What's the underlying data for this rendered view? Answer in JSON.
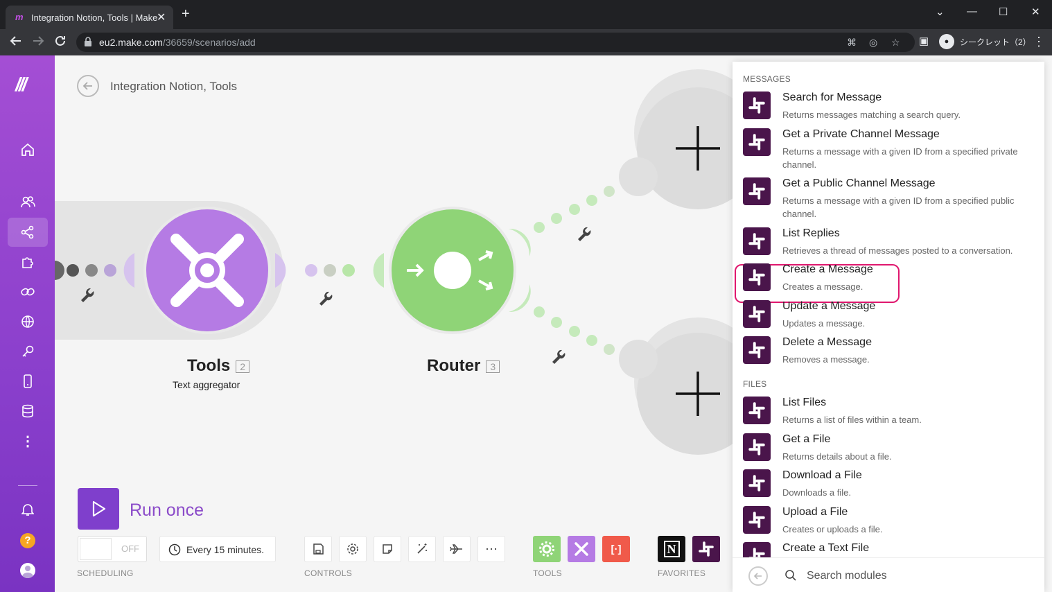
{
  "browser": {
    "tab_title": "Integration Notion, Tools | Make",
    "tab_close": "✕",
    "new_tab": "+",
    "url_host": "eu2.make.com",
    "url_path": "/36659/scenarios/add",
    "profile_label": "シークレット（2）",
    "window_controls": [
      "⌄",
      "—",
      "☐",
      "✕"
    ]
  },
  "scenario": {
    "title": "Integration Notion, Tools"
  },
  "modules": {
    "tools": {
      "name": "Tools",
      "number": "2",
      "subtitle": "Text aggregator"
    },
    "router": {
      "name": "Router",
      "number": "3"
    }
  },
  "footer": {
    "run_once": "Run once",
    "toggle_state": "OFF",
    "schedule": "Every 15 minutes.",
    "scheduling_label": "SCHEDULING",
    "controls_label": "CONTROLS",
    "tools_label": "TOOLS",
    "favorites_label": "FAVORITES"
  },
  "panel": {
    "groups": [
      {
        "label": "MESSAGES",
        "items": [
          {
            "name": "Search for Message",
            "desc": "Returns messages matching a search query."
          },
          {
            "name": "Get a Private Channel Message",
            "desc": "Returns a message with a given ID from a specified private channel."
          },
          {
            "name": "Get a Public Channel Message",
            "desc": "Returns a message with a given ID from a specified public channel."
          },
          {
            "name": "List Replies",
            "desc": "Retrieves a thread of messages posted to a conversation."
          },
          {
            "name": "Create a Message",
            "desc": "Creates a message."
          },
          {
            "name": "Update a Message",
            "desc": "Updates a message."
          },
          {
            "name": "Delete a Message",
            "desc": "Removes a message."
          }
        ]
      },
      {
        "label": "FILES",
        "items": [
          {
            "name": "List Files",
            "desc": "Returns a list of files within a team."
          },
          {
            "name": "Get a File",
            "desc": "Returns details about a file."
          },
          {
            "name": "Download a File",
            "desc": "Downloads a file."
          },
          {
            "name": "Upload a File",
            "desc": "Creates or uploads a file."
          },
          {
            "name": "Create a Text File",
            "desc": ""
          }
        ]
      }
    ],
    "search_placeholder": "Search modules"
  },
  "colors": {
    "sidebar_top": "#a44ed4",
    "accent_purple": "#7f3fcc",
    "tools_module": "#b57be4",
    "router_module": "#8fd477",
    "slack": "#4a154b",
    "highlight": "#e0176e"
  }
}
